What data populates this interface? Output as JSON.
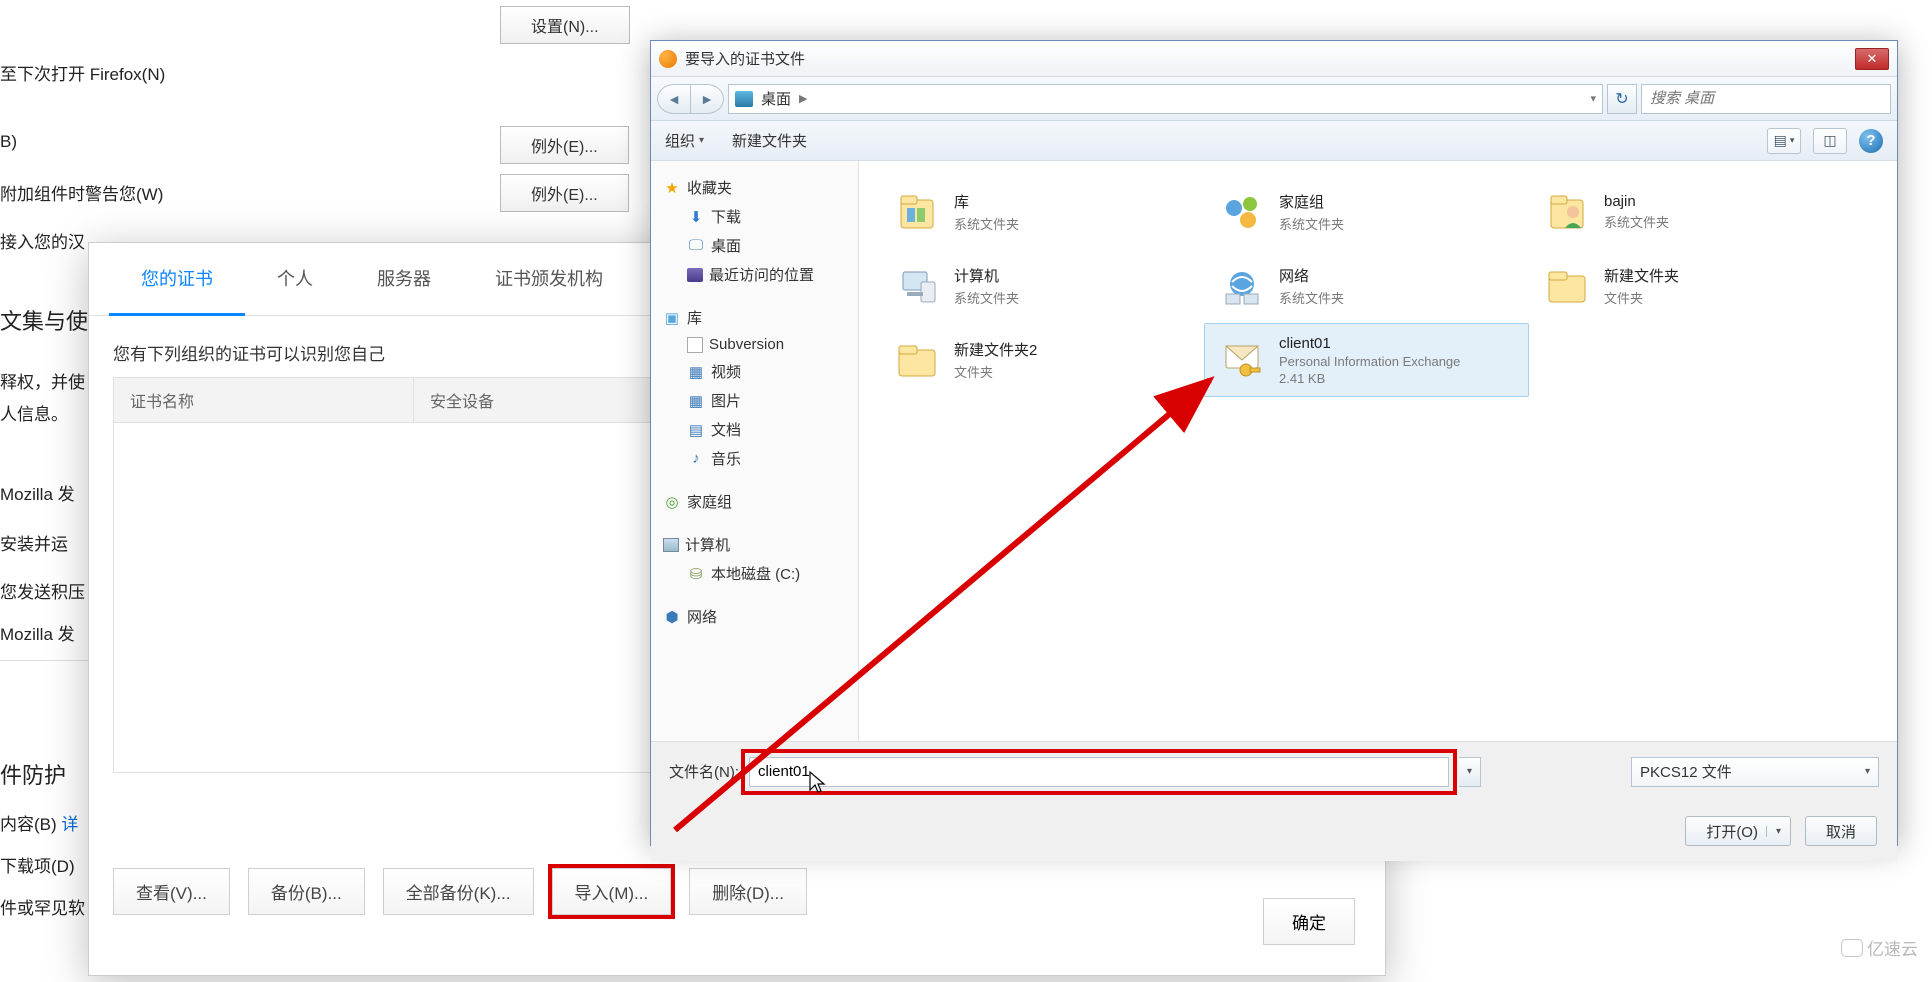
{
  "bg": {
    "settings_btn": "设置(N)...",
    "next_open": "至下次打开 Firefox(N)",
    "b_label": "B)",
    "exception1": "例外(E)...",
    "warn_addons": "附加组件时警告您(W)",
    "exception2": "例外(E)...",
    "access_text": "接入您的汉",
    "collect_title": "文集与使",
    "right_title": "释权，并使",
    "info_text": "人信息。",
    "mozilla1": "Mozilla 发",
    "install_run": "安装并运",
    "send_backlog": "您发送积压",
    "mozilla2": "Mozilla 发",
    "protection_title": "件防护",
    "content_b": "内容(B)",
    "download_d": "下载项(D)",
    "rare_files": "件或罕见软",
    "know_more": "详"
  },
  "cert": {
    "tabs": [
      "您的证书",
      "个人",
      "服务器",
      "证书颁发机构"
    ],
    "desc": "您有下列组织的证书可以识别您自己",
    "th1": "证书名称",
    "th2": "安全设备",
    "btn_view": "查看(V)...",
    "btn_backup": "备份(B)...",
    "btn_backup_all": "全部备份(K)...",
    "btn_import": "导入(M)...",
    "btn_delete": "删除(D)...",
    "btn_ok": "确定"
  },
  "fd": {
    "title": "要导入的证书文件",
    "breadcrumb": "桌面",
    "search_ph": "搜索 桌面",
    "tool_org": "组织",
    "tool_newfolder": "新建文件夹",
    "sb": {
      "fav": "收藏夹",
      "downloads": "下载",
      "desktop": "桌面",
      "recent": "最近访问的位置",
      "lib": "库",
      "subversion": "Subversion",
      "video": "视频",
      "pic": "图片",
      "docs": "文档",
      "music": "音乐",
      "homegroup": "家庭组",
      "computer": "计算机",
      "localdisk": "本地磁盘 (C:)",
      "network": "网络"
    },
    "files": [
      {
        "name": "库",
        "sub": "系统文件夹",
        "icon": "lib"
      },
      {
        "name": "家庭组",
        "sub": "系统文件夹",
        "icon": "homegroup"
      },
      {
        "name": "bajin",
        "sub": "系统文件夹",
        "icon": "user"
      },
      {
        "name": "计算机",
        "sub": "系统文件夹",
        "icon": "computer"
      },
      {
        "name": "网络",
        "sub": "系统文件夹",
        "icon": "network"
      },
      {
        "name": "新建文件夹",
        "sub": "文件夹",
        "icon": "folder"
      },
      {
        "name": "新建文件夹2",
        "sub": "文件夹",
        "icon": "folder"
      },
      {
        "name": "client01",
        "sub": "Personal Information Exchange",
        "sub2": "2.41 KB",
        "icon": "cert",
        "selected": true
      }
    ],
    "fn_label": "文件名(N):",
    "fn_value": "client01",
    "filter": "PKCS12 文件",
    "btn_open": "打开(O)",
    "btn_cancel": "取消"
  },
  "watermark": "亿速云"
}
